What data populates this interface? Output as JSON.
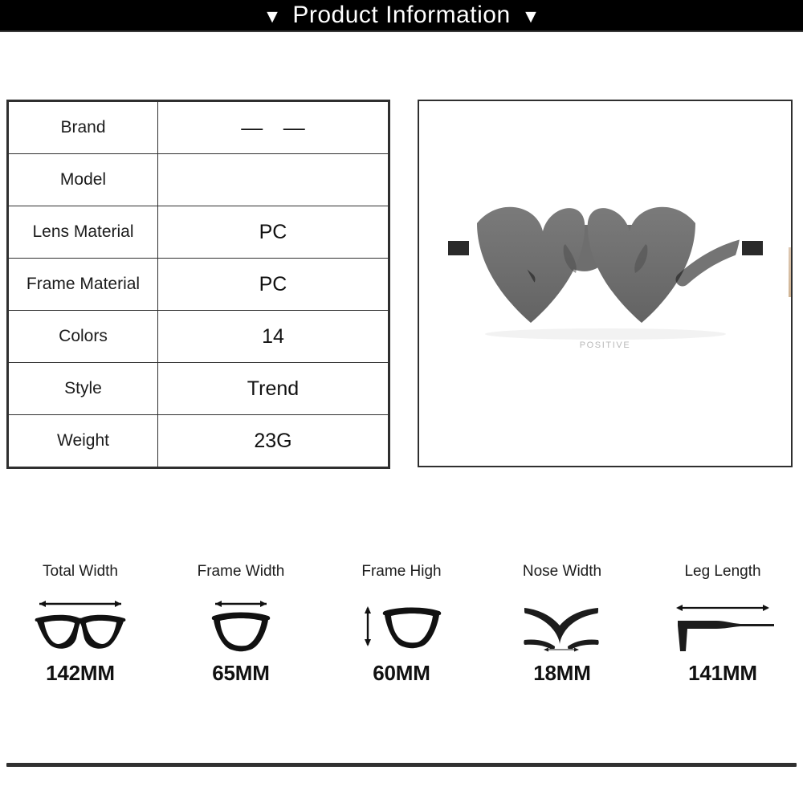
{
  "header": {
    "title": "Product Information",
    "left_triangle": "▼",
    "right_triangle": "▼",
    "background_color": "#000000",
    "text_color": "#ffffff"
  },
  "spec_table": {
    "rows": [
      {
        "key": "Brand",
        "value": "— —"
      },
      {
        "key": "Model",
        "value": ""
      },
      {
        "key": "Lens Material",
        "value": "PC"
      },
      {
        "key": "Frame Material",
        "value": "PC"
      },
      {
        "key": "Colors",
        "value": "14"
      },
      {
        "key": "Style",
        "value": "Trend"
      },
      {
        "key": "Weight",
        "value": "23G"
      }
    ]
  },
  "product_panel": {
    "caption": "POSITIVE",
    "lens_color": "#6e6e6e",
    "arm_color": "#3f3f3f",
    "caption_color": "#b9b9b9"
  },
  "measurements": [
    {
      "label": "Total Width",
      "value": "142MM",
      "icon": "glasses-front-icon"
    },
    {
      "label": "Frame Width",
      "value": "65MM",
      "icon": "frame-single-lens-icon"
    },
    {
      "label": "Frame High",
      "value": "60MM",
      "icon": "frame-height-icon"
    },
    {
      "label": "Nose Width",
      "value": "18MM",
      "icon": "nose-bridge-icon"
    },
    {
      "label": "Leg Length",
      "value": "141MM",
      "icon": "temple-arm-icon"
    }
  ]
}
